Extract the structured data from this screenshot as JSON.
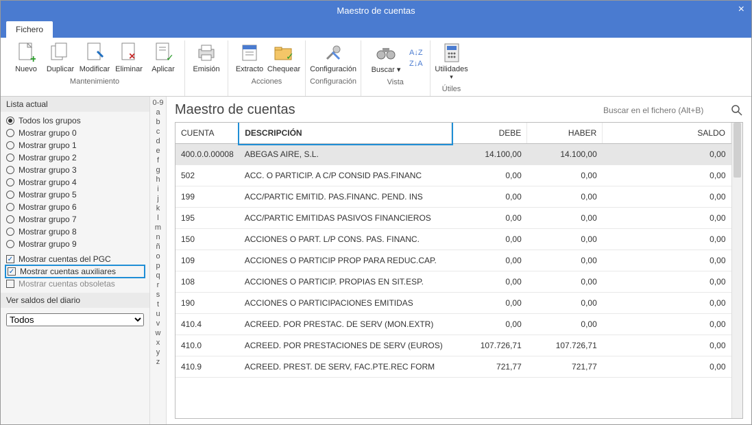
{
  "window": {
    "title": "Maestro de cuentas"
  },
  "tabs": {
    "file": "Fichero"
  },
  "ribbon": {
    "maintenance": {
      "label": "Mantenimiento",
      "new": "Nuevo",
      "duplicate": "Duplicar",
      "modify": "Modificar",
      "delete": "Eliminar",
      "apply": "Aplicar"
    },
    "emission": {
      "label": "Emisión"
    },
    "actions": {
      "label": "Acciones",
      "extract": "Extracto",
      "check": "Chequear"
    },
    "configuration": {
      "label": "Configuración",
      "config": "Configuración"
    },
    "view": {
      "label": "Vista",
      "search": "Buscar"
    },
    "utils": {
      "label": "Útiles",
      "utilities": "Utilidades"
    }
  },
  "sidebar": {
    "list_title": "Lista actual",
    "groups": [
      "Todos los grupos",
      "Mostrar grupo 0",
      "Mostrar grupo 1",
      "Mostrar grupo 2",
      "Mostrar grupo 3",
      "Mostrar grupo 4",
      "Mostrar grupo 5",
      "Mostrar grupo 6",
      "Mostrar grupo 7",
      "Mostrar grupo 8",
      "Mostrar grupo 9"
    ],
    "checks": {
      "pgc": "Mostrar cuentas del PGC",
      "aux": "Mostrar cuentas auxiliares",
      "obs": "Mostrar cuentas obsoletas"
    },
    "balances_title": "Ver saldos del diario",
    "balances_value": "Todos"
  },
  "az": [
    "0-9",
    "a",
    "b",
    "c",
    "d",
    "e",
    "f",
    "g",
    "h",
    "i",
    "j",
    "k",
    "l",
    "m",
    "n",
    "ñ",
    "o",
    "p",
    "q",
    "r",
    "s",
    "t",
    "u",
    "v",
    "w",
    "x",
    "y",
    "z"
  ],
  "main": {
    "title": "Maestro de cuentas",
    "search_placeholder": "Buscar en el fichero (Alt+B)",
    "columns": {
      "account": "CUENTA",
      "desc": "DESCRIPCIÓN",
      "debit": "DEBE",
      "credit": "HABER",
      "balance": "SALDO"
    },
    "rows": [
      {
        "account": "400.0.0.00008",
        "desc": "ABEGAS AIRE, S.L.",
        "debit": "14.100,00",
        "credit": "14.100,00",
        "balance": "0,00",
        "sel": true
      },
      {
        "account": "502",
        "desc": "ACC. O PARTICIP. A C/P CONSID PAS.FINANC",
        "debit": "0,00",
        "credit": "0,00",
        "balance": "0,00"
      },
      {
        "account": "199",
        "desc": "ACC/PARTIC EMITID. PAS.FINANC. PEND. INS",
        "debit": "0,00",
        "credit": "0,00",
        "balance": "0,00"
      },
      {
        "account": "195",
        "desc": "ACC/PARTIC EMITIDAS PASIVOS FINANCIEROS",
        "debit": "0,00",
        "credit": "0,00",
        "balance": "0,00"
      },
      {
        "account": "150",
        "desc": "ACCIONES O PART. L/P CONS. PAS. FINANC.",
        "debit": "0,00",
        "credit": "0,00",
        "balance": "0,00"
      },
      {
        "account": "109",
        "desc": "ACCIONES O PARTICIP PROP PARA REDUC.CAP.",
        "debit": "0,00",
        "credit": "0,00",
        "balance": "0,00"
      },
      {
        "account": "108",
        "desc": "ACCIONES O PARTICIP. PROPIAS EN SIT.ESP.",
        "debit": "0,00",
        "credit": "0,00",
        "balance": "0,00"
      },
      {
        "account": "190",
        "desc": "ACCIONES O PARTICIPACIONES EMITIDAS",
        "debit": "0,00",
        "credit": "0,00",
        "balance": "0,00"
      },
      {
        "account": "410.4",
        "desc": "ACREED. POR PRESTAC. DE SERV (MON.EXTR)",
        "debit": "0,00",
        "credit": "0,00",
        "balance": "0,00"
      },
      {
        "account": "410.0",
        "desc": "ACREED. POR PRESTACIONES DE SERV (EUROS)",
        "debit": "107.726,71",
        "credit": "107.726,71",
        "balance": "0,00"
      },
      {
        "account": "410.9",
        "desc": "ACREED. PREST. DE SERV, FAC.PTE.REC FORM",
        "debit": "721,77",
        "credit": "721,77",
        "balance": "0,00"
      }
    ]
  }
}
